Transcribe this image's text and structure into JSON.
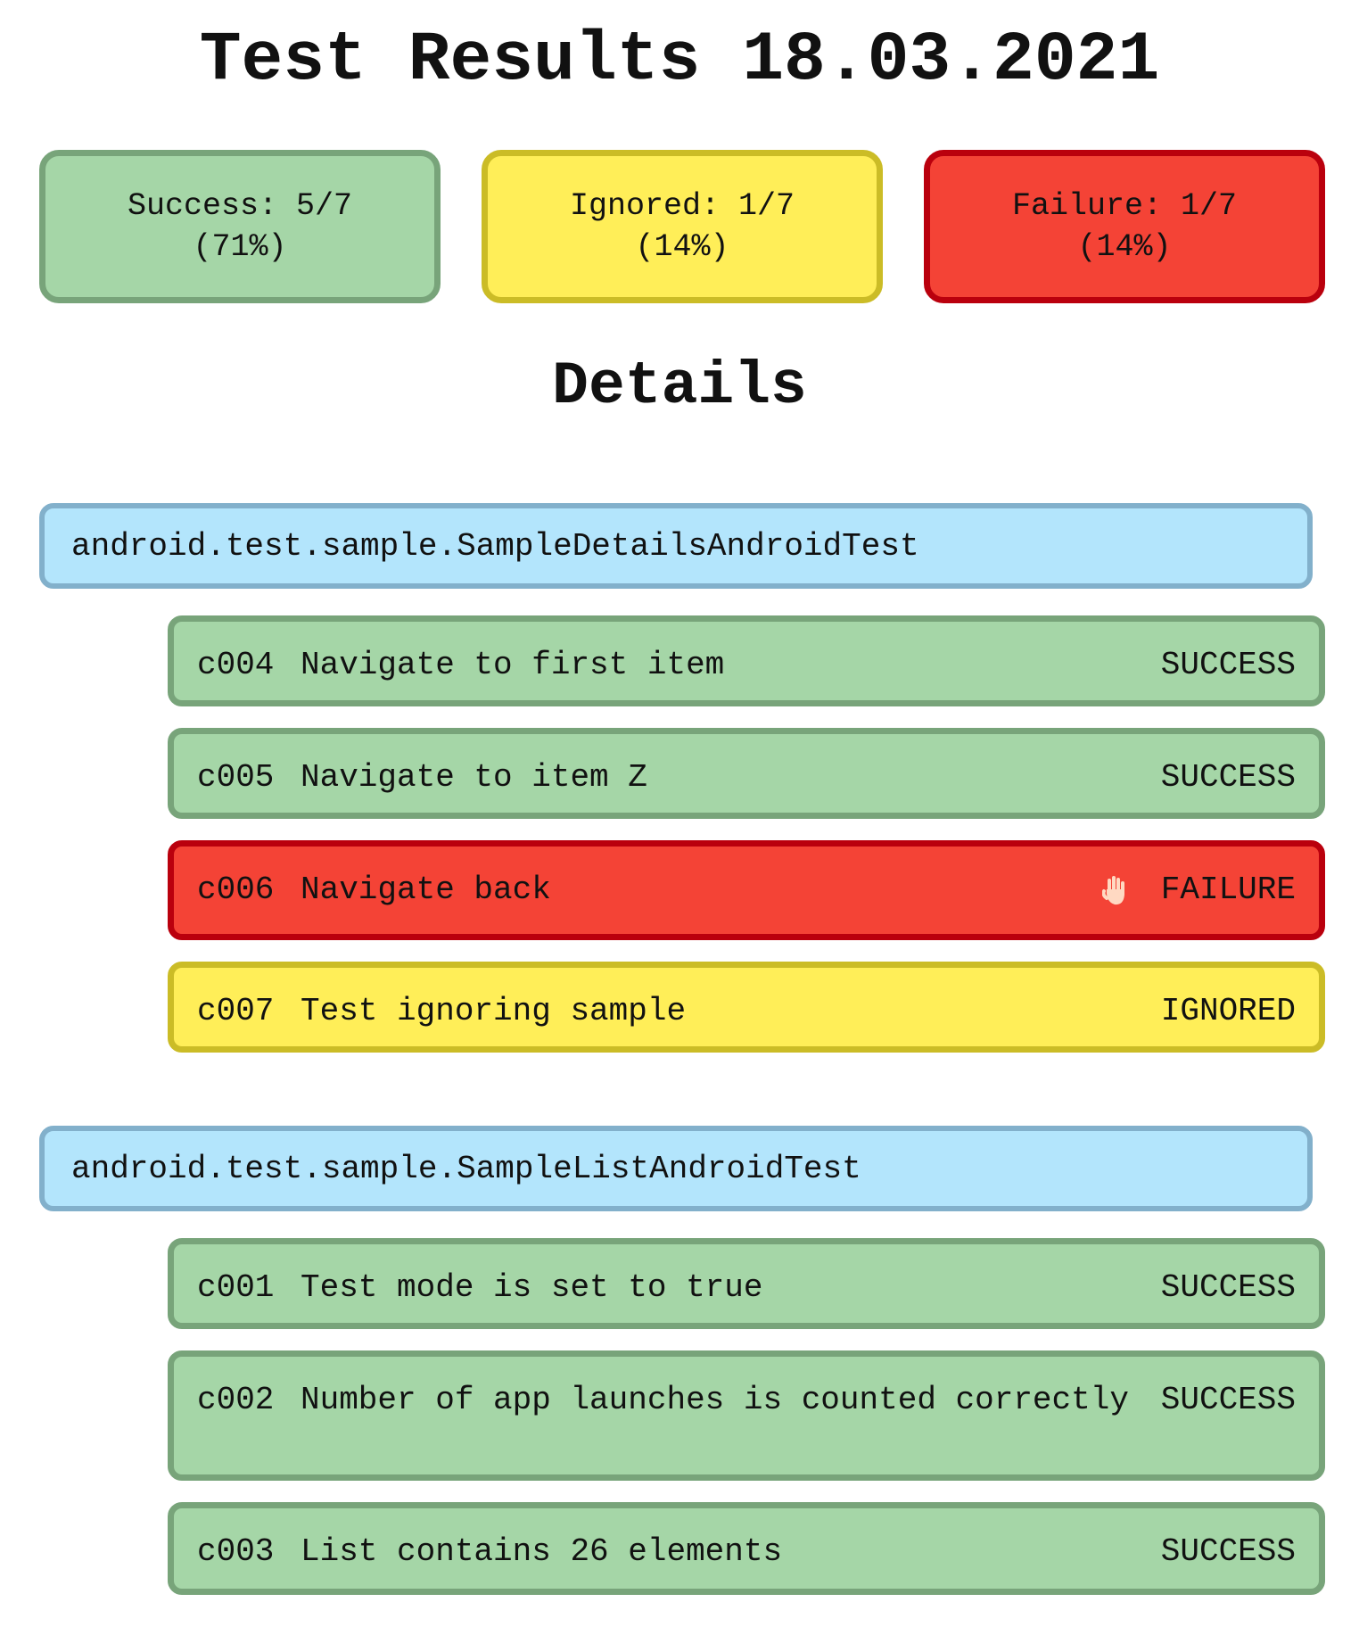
{
  "title": "Test Results 18.03.2021",
  "summary": {
    "success": {
      "label": "Success: 5/7",
      "percent": "(71%)"
    },
    "ignored": {
      "label": "Ignored: 1/7",
      "percent": "(14%)"
    },
    "failure": {
      "label": "Failure: 1/7",
      "percent": "(14%)"
    }
  },
  "details_title": "Details",
  "colors": {
    "success_fill": "#a5d6a7",
    "success_border": "#78a47a",
    "ignored_fill": "#ffee58",
    "ignored_border": "#cbbc26",
    "failure_fill": "#f44336",
    "failure_border": "#ba000d",
    "group_fill": "#b3e5fc",
    "group_border": "#82b0cb"
  },
  "groups": [
    {
      "name": "android.test.sample.SampleDetailsAndroidTest",
      "tests": [
        {
          "id": "c004",
          "name": "Navigate to first item",
          "status": "SUCCESS"
        },
        {
          "id": "c005",
          "name": "Navigate to item Z",
          "status": "SUCCESS"
        },
        {
          "id": "c006",
          "name": "Navigate back",
          "status": "FAILURE",
          "cursor_icon": "hand-pointer-icon"
        },
        {
          "id": "c007",
          "name": "Test ignoring sample",
          "status": "IGNORED"
        }
      ]
    },
    {
      "name": "android.test.sample.SampleListAndroidTest",
      "tests": [
        {
          "id": "c001",
          "name": "Test mode is set to true",
          "status": "SUCCESS"
        },
        {
          "id": "c002",
          "name": "Number of app launches is counted correctly",
          "status": "SUCCESS"
        },
        {
          "id": "c003",
          "name": "List contains 26 elements",
          "status": "SUCCESS"
        }
      ]
    }
  ]
}
